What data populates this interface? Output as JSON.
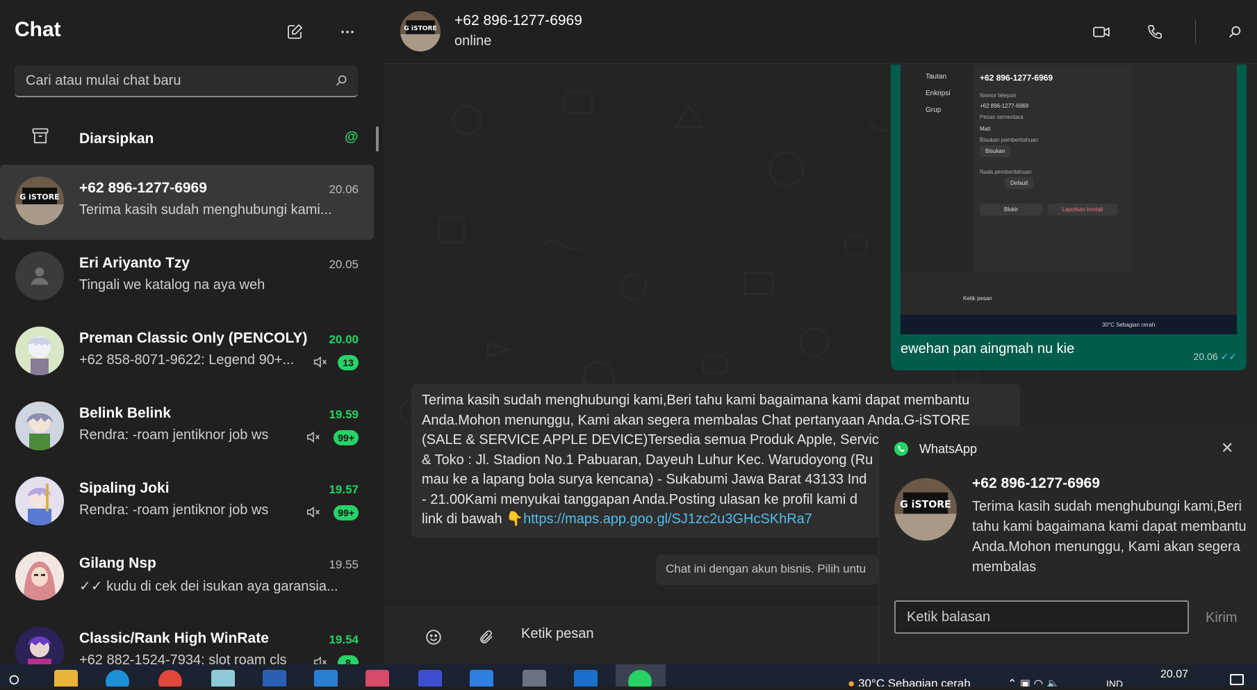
{
  "sidebar": {
    "title": "Chat",
    "search_placeholder": "Cari atau mulai chat baru",
    "archived_label": "Diarsipkan",
    "archived_mark": "@",
    "chats": [
      {
        "name": "+62 896-1277-6969",
        "time": "20.06",
        "preview": "Terima kasih sudah menghubungi kami...",
        "muted": false,
        "badge": "",
        "time_green": false,
        "active": true,
        "avatar": "istore-logo"
      },
      {
        "name": "Eri Ariyanto Tzy",
        "time": "20.05",
        "preview": "Tingali we katalog na aya weh",
        "muted": false,
        "badge": "",
        "time_green": false,
        "active": false,
        "avatar": "default-user"
      },
      {
        "name": "Preman Classic Only (PENCOLY)",
        "time": "20.00",
        "preview": "+62 858-8071-9622: Legend 90+...",
        "muted": true,
        "badge": "13",
        "time_green": true,
        "active": false,
        "avatar": "anime-white"
      },
      {
        "name": "Belink Belink",
        "time": "19.59",
        "preview": "Rendra: -roam jentiknor job ws",
        "muted": true,
        "badge": "99+",
        "time_green": true,
        "active": false,
        "avatar": "anime-blue"
      },
      {
        "name": "Sipaling Joki",
        "time": "19.57",
        "preview": "Rendra: -roam jentiknor job ws",
        "muted": true,
        "badge": "99+",
        "time_green": true,
        "active": false,
        "avatar": "anime-purple"
      },
      {
        "name": "Gilang Nsp",
        "time": "19.55",
        "preview": "✓✓ kudu di cek dei isukan aya garansia...",
        "muted": false,
        "badge": "",
        "time_green": false,
        "active": false,
        "avatar": "hijab-girl"
      },
      {
        "name": "Classic/Rank High WinRate",
        "time": "19.54",
        "preview": "+62 882-1524-7934: slot roam cls",
        "muted": true,
        "badge": "8",
        "time_green": true,
        "active": false,
        "avatar": "anime-dark"
      }
    ]
  },
  "header": {
    "name": "+62 896-1277-6969",
    "status": "online"
  },
  "messages": {
    "outgoing": {
      "caption": "ewehan pan aingmah nu kie",
      "time": "20.06",
      "screenshot": {
        "menu": [
          "Tautan",
          "Enkripsi",
          "Grup"
        ],
        "contact": "+62 896-1277-6969",
        "phone_label": "Nomor telepon",
        "phone": "+62 896-1277-6969",
        "temp_label": "Pesan sementara",
        "temp_value": "Mati",
        "mute_label": "Bisukan pemberitahuan",
        "mute_value": "Bisukan",
        "tone_label": "Nada pemberitahuan",
        "tone_value": "Default",
        "block": "Blokir",
        "report": "Laporkan kontak",
        "input": "Ketik pesan",
        "weather": "30°C  Sebagian cerah"
      }
    },
    "incoming": {
      "lines": [
        "Terima kasih sudah menghubungi kami,Beri tahu kami bagaimana kami dapat membantu",
        "Anda.Mohon menunggu, Kami akan segera membalas Chat pertanyaan Anda.G-iSTORE",
        "(SALE & SERVICE APPLE DEVICE)Tersedia semua Produk Apple, Service",
        "& Toko : Jl. Stadion No.1 Pabuaran, Dayeuh Luhur Kec. Warudoyong (Ru",
        "mau ke a lapang bola surya kencana) - Sukabumi Jawa Barat 43133 Ind",
        "- 21.00Kami menyukai tanggapan Anda.Posting ulasan ke profil kami d"
      ],
      "link_prefix": "link di bawah 👇",
      "link": "https://maps.app.goo.gl/SJ1zc2u3GHcSKhRa7"
    },
    "system_note": "Chat ini dengan akun bisnis. Pilih untu"
  },
  "composer": {
    "placeholder": "Ketik pesan"
  },
  "notification": {
    "app": "WhatsApp",
    "title": "+62 896-1277-6969",
    "body": "Terima kasih sudah menghubungi kami,Beri tahu kami bagaimana kami dapat membantu Anda.Mohon menunggu, Kami akan segera membalas",
    "reply_placeholder": "Ketik balasan",
    "send": "Kirim"
  },
  "taskbar": {
    "weather": "30°C  Sebagian cerah",
    "lang": "IND",
    "time": "20.07"
  },
  "colors": {
    "accent": "#25d366",
    "outgoing_bubble": "#005c4b",
    "link": "#53bdeb"
  }
}
